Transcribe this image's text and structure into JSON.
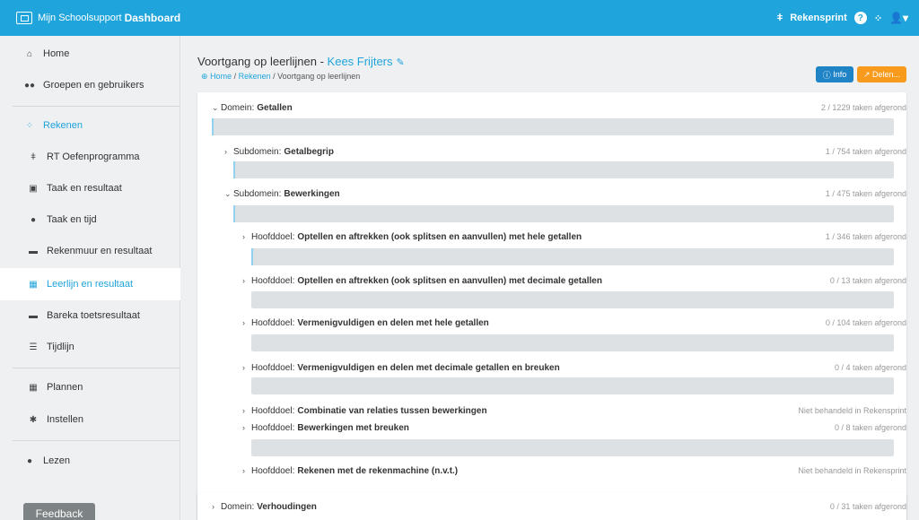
{
  "header": {
    "app_prefix": "Mijn Schoolsupport",
    "app_title": "Dashboard",
    "program": "Rekensprint",
    "help_icon": "question-circle-icon",
    "apps_icon": "grid-icon",
    "user_icon": "user-icon"
  },
  "sidebar": {
    "items": [
      {
        "label": "Home",
        "icon": "home-icon"
      },
      {
        "label": "Groepen en gebruikers",
        "icon": "users-icon"
      },
      {
        "label": "Rekenen",
        "icon": "grid-icon"
      },
      {
        "label": "RT Oefenprogramma",
        "icon": "runner-icon"
      },
      {
        "label": "Taak en resultaat",
        "icon": "chart-square-icon"
      },
      {
        "label": "Taak en tijd",
        "icon": "stopwatch-icon"
      },
      {
        "label": "Rekenmuur en resultaat",
        "icon": "wall-icon"
      },
      {
        "label": "Leerlijn en resultaat",
        "icon": "calendar-check-icon"
      },
      {
        "label": "Bareka toetsresultaat",
        "icon": "wall-icon"
      },
      {
        "label": "Tijdlijn",
        "icon": "list-icon"
      },
      {
        "label": "Plannen",
        "icon": "calendar-icon"
      },
      {
        "label": "Instellen",
        "icon": "gear-icon"
      },
      {
        "label": "Lezen",
        "icon": "reader-icon"
      }
    ],
    "feedback": "Feedback"
  },
  "page": {
    "title": "Voortgang op leerlijnen - ",
    "student": "Kees Frijters",
    "breadcrumb": [
      "Home",
      "Rekenen",
      "Voortgang op leerlijnen"
    ],
    "info_button": "Info",
    "share_button": "Delen..."
  },
  "tree": [
    {
      "level": "domain",
      "prefix": "Domein:",
      "name": "Getallen",
      "count": "2 / 1229 taken afgerond",
      "expanded": true,
      "progress": 0.002
    },
    {
      "level": "subdomain",
      "prefix": "Subdomein:",
      "name": "Getalbegrip",
      "count": "1 / 754 taken afgerond",
      "expanded": false,
      "progress": 0.002
    },
    {
      "level": "subdomain",
      "prefix": "Subdomein:",
      "name": "Bewerkingen",
      "count": "1 / 475 taken afgerond",
      "expanded": true,
      "progress": 0.002
    },
    {
      "level": "goal",
      "prefix": "Hoofddoel:",
      "name": "Optellen en aftrekken (ook splitsen en aanvullen) met hele getallen",
      "count": "1 / 346 taken afgerond",
      "progress": 0.003
    },
    {
      "level": "goal",
      "prefix": "Hoofddoel:",
      "name": "Optellen en aftrekken (ook splitsen en aanvullen) met decimale getallen",
      "count": "0 / 13 taken afgerond",
      "progress": 0
    },
    {
      "level": "goal",
      "prefix": "Hoofddoel:",
      "name": "Vermenigvuldigen en delen met hele getallen",
      "count": "0 / 104 taken afgerond",
      "progress": 0
    },
    {
      "level": "goal",
      "prefix": "Hoofddoel:",
      "name": "Vermenigvuldigen en delen met decimale getallen en breuken",
      "count": "0 / 4 taken afgerond",
      "progress": 0
    },
    {
      "level": "goal",
      "prefix": "Hoofddoel:",
      "name": "Combinatie van relaties tussen bewerkingen",
      "count": "Niet behandeld in Rekensprint"
    },
    {
      "level": "goal",
      "prefix": "Hoofddoel:",
      "name": "Bewerkingen met breuken",
      "count": "0 / 8 taken afgerond",
      "progress": 0
    },
    {
      "level": "goal",
      "prefix": "Hoofddoel:",
      "name": "Rekenen met de rekenmachine (n.v.t.)",
      "count": "Niet behandeld in Rekensprint"
    },
    {
      "level": "domain",
      "prefix": "Domein:",
      "name": "Verhoudingen",
      "count": "0 / 31 taken afgerond",
      "expanded": false
    }
  ]
}
